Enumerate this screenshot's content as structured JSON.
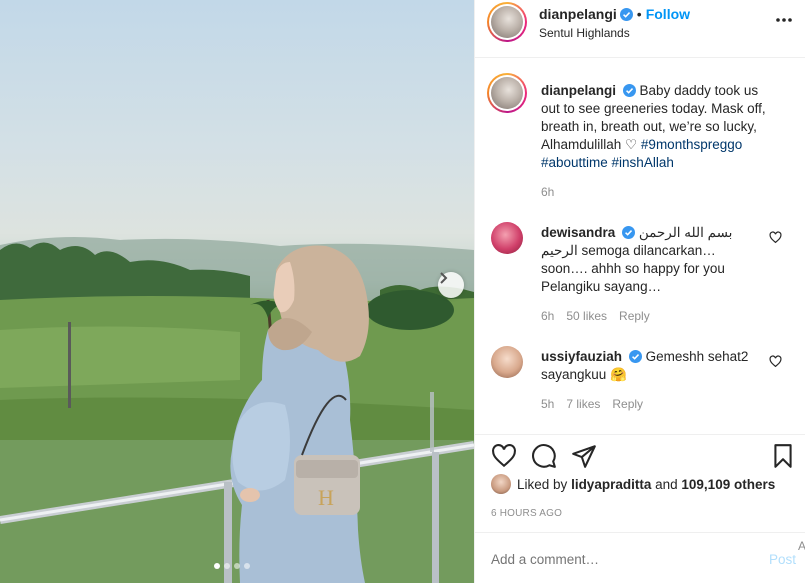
{
  "post": {
    "username": "dianpelangi",
    "location": "Sentul Highlands",
    "follow_label": "Follow",
    "separator": "•",
    "more_icon": "more-horizontal-icon"
  },
  "caption": {
    "username": "dianpelangi",
    "text": "Baby daddy took us out to see greeneries today. Mask off, breath in, breath out, we’re so lucky, Alhamdulillah ♡",
    "hashtags": "#9monthspreggo #abouttime #inshAllah",
    "time": "6h"
  },
  "comments": [
    {
      "username": "dewisandra",
      "text": "بسم الله الرحمن الرحيم semoga dilancarkan… soon…. ahhh so happy for you Pelangiku sayang…",
      "time": "6h",
      "likes": "50 likes",
      "reply": "Reply"
    },
    {
      "username": "ussiyfauziah",
      "text": "Gemeshh sehat2 sayangkuu 🤗",
      "time": "5h",
      "likes": "7 likes",
      "reply": "Reply"
    }
  ],
  "likes": {
    "prefix": "Liked by",
    "user": "lidyapraditta",
    "middle": "and",
    "count": "109,109 others"
  },
  "timestamp": "6 HOURS AGO",
  "add_comment": {
    "placeholder": "Add a comment…",
    "post_label": "Post",
    "stray_char": "A"
  },
  "colors": {
    "accent": "#0095f6",
    "hashtag": "#00376b",
    "muted": "#8e8e8e"
  },
  "carousel": {
    "slides": 4,
    "active_index": 0
  }
}
